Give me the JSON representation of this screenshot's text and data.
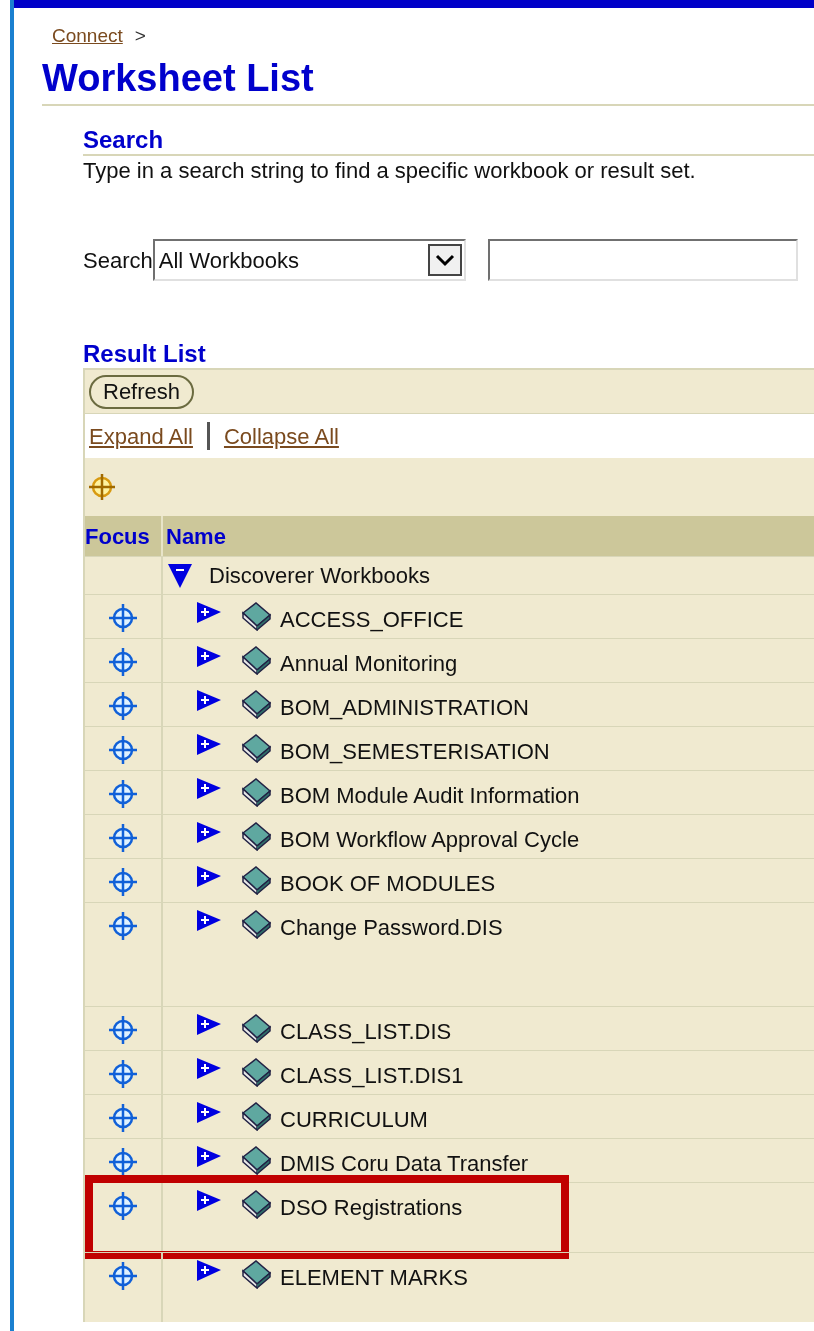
{
  "breadcrumb": [
    {
      "label": "Connect",
      "separator": ">"
    }
  ],
  "title": "Worksheet List",
  "search": {
    "heading": "Search",
    "description": "Type in a search string to find a specific workbook or result set.",
    "label": "Search",
    "scope": "All Workbooks"
  },
  "result_list": {
    "heading": "Result List",
    "refresh_button": "Refresh",
    "links": [
      "Expand All",
      "Collapse All"
    ],
    "columns": [
      "Focus",
      "Name"
    ],
    "tree": {
      "label": "Discoverer Workbooks",
      "expanded": true,
      "children": [
        {
          "label": "ACCESS_OFFICE",
          "expanded": false,
          "highlighted": false
        },
        {
          "label": "Annual Monitoring",
          "expanded": false,
          "highlighted": false
        },
        {
          "label": "BOM_ADMINISTRATION",
          "expanded": false,
          "highlighted": false
        },
        {
          "label": "BOM_SEMESTERISATION",
          "expanded": false,
          "highlighted": false
        },
        {
          "label": "BOM Module Audit Information",
          "expanded": false,
          "highlighted": false
        },
        {
          "label": "BOM Workflow Approval Cycle",
          "expanded": false,
          "highlighted": false
        },
        {
          "label": "BOOK OF MODULES",
          "expanded": false,
          "highlighted": false
        },
        {
          "label": "Change Password.DIS",
          "expanded": false,
          "highlighted": false
        },
        {
          "label": "CLASS_LIST.DIS",
          "expanded": false,
          "highlighted": false
        },
        {
          "label": "CLASS_LIST.DIS1",
          "expanded": false,
          "highlighted": false
        },
        {
          "label": "CURRICULUM",
          "expanded": false,
          "highlighted": false
        },
        {
          "label": "DMIS Coru Data Transfer",
          "expanded": false,
          "highlighted": false
        },
        {
          "label": "DSO Registrations",
          "expanded": false,
          "highlighted": true
        },
        {
          "label": "ELEMENT MARKS",
          "expanded": false,
          "highlighted": false
        }
      ]
    }
  }
}
